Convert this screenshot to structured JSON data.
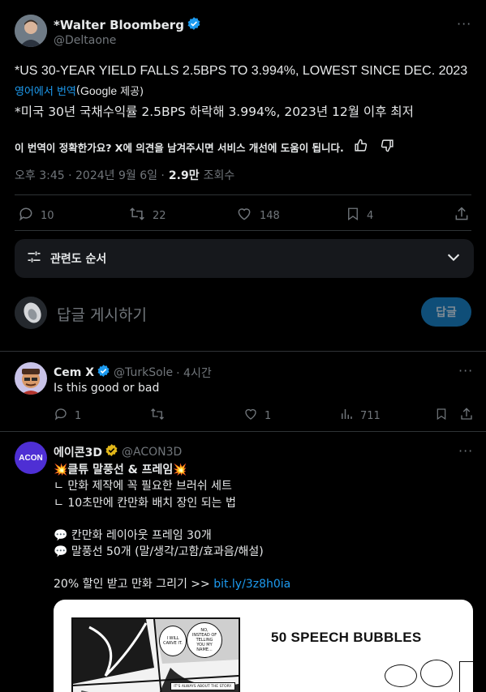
{
  "main_tweet": {
    "author_name": "*Walter Bloomberg",
    "handle": "@Deltaone",
    "text": "*US 30-YEAR YIELD FALLS 2.5BPS TO 3.994%, LOWEST SINCE DEC. 2023",
    "translate_link": "영어에서 번역",
    "translate_provider_prefix": "(",
    "translate_provider_brand": "Google",
    "translate_provider_suffix": "제공)",
    "translated_text": "*미국 30년 국채수익률 2.5BPS 하락해 3.994%, 2023년 12월 이후 최저",
    "feedback_prompt": "이 번역이 정확한가요? X에 의견을 남겨주시면 서비스 개선에 도움이 됩니다.",
    "timestamp": "오후 3:45 · 2024년 9월 6일 ·",
    "views_count": "2.9만",
    "views_label": "조회수",
    "actions": {
      "replies": "10",
      "retweets": "22",
      "likes": "148",
      "bookmarks": "4"
    }
  },
  "sort": {
    "label": "관련도 순서"
  },
  "reply_box": {
    "placeholder": "답글 게시하기",
    "button_label": "답글"
  },
  "replies": [
    {
      "author_name": "Cem X",
      "handle": "@TurkSole",
      "time": "· 4시간",
      "text": "Is this good or bad",
      "actions": {
        "replies": "1",
        "retweets": "",
        "likes": "1",
        "views": "711"
      }
    }
  ],
  "ad_post": {
    "author_name": "에이콘3D",
    "handle": "@ACON3D",
    "avatar_text": "ACON",
    "lines": [
      "💥클튜 말풍선 & 프레임💥",
      "ㄴ 만화 제작에 꼭 필요한 브러쉬 세트",
      "ㄴ 10초만에 칸만화 배치 장인 되는 법",
      "",
      "💬 칸만화 레이아웃 프레임 30개",
      "💬 말풍선 50개 (말/생각/고함/효과음/해설)",
      "",
      "20% 할인 받고 만화 그리기 >>"
    ],
    "link_text": "bit.ly/3z8h0ia",
    "media": {
      "bubble_texts": [
        "I WILL CARVE IT.",
        "NO, INSTEAD OF TELLING YOU MY NAME...",
        "IT'S ALWAYS ABOUT THE STORY."
      ],
      "headline": "50 SPEECH BUBBLES"
    }
  },
  "colors": {
    "background": "#000000",
    "text": "#e7e9ea",
    "muted": "#71767b",
    "accent": "#1d9bf0",
    "divider": "#2f3336",
    "verified_blue": "#1d9bf0",
    "verified_gold": "#e2b719"
  }
}
